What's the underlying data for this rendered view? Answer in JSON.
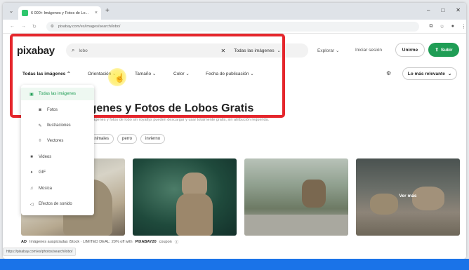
{
  "browser": {
    "tab_title": "6 000+ Imágenes y Fotos de Lo...",
    "url": "pixabay.com/es/images/search/lobo/",
    "status_url": "https://pixabay.com/es/photos/search/lobo/"
  },
  "header": {
    "logo": "pixabay",
    "search_value": "lobo",
    "search_scope": "Todas las imágenes",
    "explore": "Explorar",
    "login": "Iniciar sesión",
    "join": "Unirme",
    "upload": "Subir"
  },
  "filters": {
    "type": "Todas las imágenes",
    "orientation": "Orientación",
    "size": "Tamaño",
    "color": "Color",
    "date": "Fecha de publicación",
    "sort": "Lo más relevante"
  },
  "dropdown": {
    "items": [
      {
        "label": "Todas las imágenes",
        "icon": "image-icon",
        "selected": true
      },
      {
        "label": "Fotos",
        "icon": "camera-icon"
      },
      {
        "label": "Ilustraciones",
        "icon": "brush-icon"
      },
      {
        "label": "Vectores",
        "icon": "vector-icon"
      },
      {
        "label": "Videos",
        "icon": "video-icon"
      },
      {
        "label": "GIF",
        "icon": "gif-icon"
      },
      {
        "label": "Música",
        "icon": "music-icon"
      },
      {
        "label": "Efectos de sonido",
        "icon": "sound-icon"
      }
    ]
  },
  "main": {
    "title": "Imágenes y Fotos de Lobos Gratis",
    "subtitle": "Encuentra imágenes y fotos de lobo sin royaltys pueden descargar y usar totalmente gratis, sin atribución requerida.",
    "chips": [
      "animales",
      "perro",
      "invierno"
    ],
    "overlay_text": "Ver más",
    "sponsor": {
      "prefix": "AD",
      "text": "Imágenes auspiciadas iStock · LIMITED DEAL: 20% off with",
      "code": "PIXABAY20",
      "suffix": "coupon"
    }
  },
  "colors": {
    "accent": "#1f9d55",
    "highlight": "#e5262c",
    "taskbar": "#1a73e8"
  }
}
